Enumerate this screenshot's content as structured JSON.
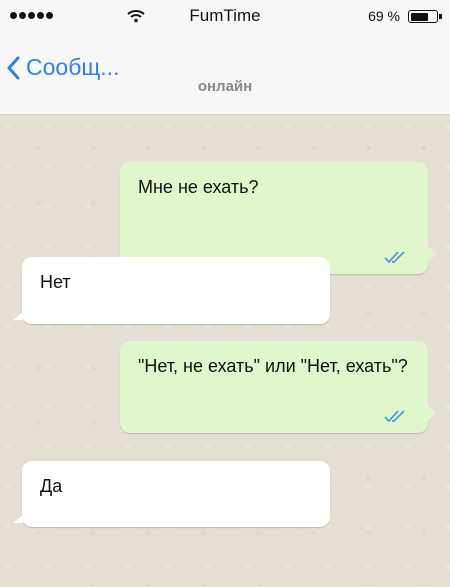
{
  "status_bar": {
    "carrier": "FumTime",
    "battery_percent": "69 %",
    "battery_level": 0.69,
    "signal_icon": "signal-dots-icon",
    "wifi_icon": "wifi-icon"
  },
  "nav": {
    "back_label": "Сообщ...",
    "status": "онлайн",
    "accent_color": "#2f80e8"
  },
  "messages": [
    {
      "direction": "outgoing",
      "text": "Мне не ехать?",
      "status_icon": "double-check-icon"
    },
    {
      "direction": "incoming",
      "text": "Нет"
    },
    {
      "direction": "outgoing",
      "text": "\"Нет, не ехать\" или \"Нет, ехать\"?",
      "status_icon": "double-check-icon"
    },
    {
      "direction": "incoming",
      "text": "Да"
    }
  ],
  "colors": {
    "outgoing_bubble": "#e1f7cb",
    "incoming_bubble": "#ffffff",
    "read_ticks": "#4a9be0"
  }
}
